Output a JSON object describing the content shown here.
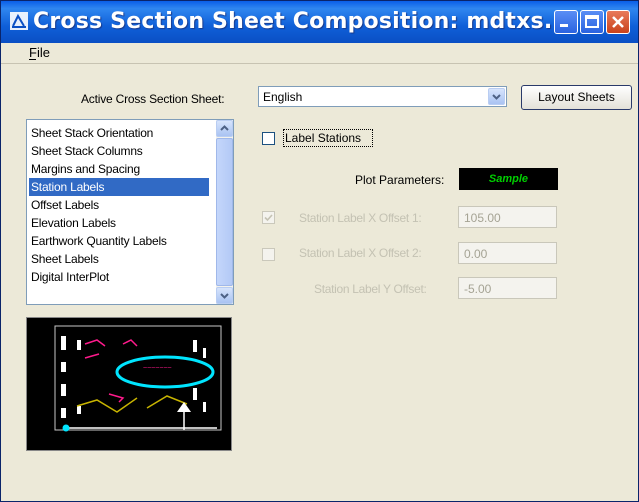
{
  "window": {
    "title": "Cross Section Sheet Composition: mdtxs..."
  },
  "menu": {
    "items": [
      "File"
    ]
  },
  "active_sheet": {
    "label": "Active Cross Section Sheet:",
    "value": "English"
  },
  "buttons": {
    "layout_sheets": "Layout Sheets"
  },
  "list": {
    "items": [
      "Sheet Stack Orientation",
      "Sheet Stack Columns",
      "Margins and Spacing",
      "Station Labels",
      "Offset Labels",
      "Elevation Labels",
      "Earthwork Quantity Labels",
      "Sheet Labels",
      "Digital InterPlot"
    ],
    "selected": "Station Labels"
  },
  "label_stations": {
    "label": "Label Stations",
    "checked": false
  },
  "plot_parameters": {
    "label": "Plot Parameters:",
    "button": "Sample"
  },
  "fields": [
    {
      "label": "Station Label X Offset 1:",
      "value": "105.00",
      "checkbox": true,
      "checked": true
    },
    {
      "label": "Station Label X Offset 2:",
      "value": "0.00",
      "checkbox": true,
      "checked": false
    },
    {
      "label": "Station Label Y Offset:",
      "value": "-5.00",
      "checkbox": false
    }
  ],
  "colors": {
    "titlebar": "#0a5ee8",
    "selection": "#316ac5",
    "sample_text": "#00d000",
    "preview_ellipse": "#00e5ff",
    "preview_labels": "#ff1a8c",
    "preview_lines": "#c8b400"
  }
}
